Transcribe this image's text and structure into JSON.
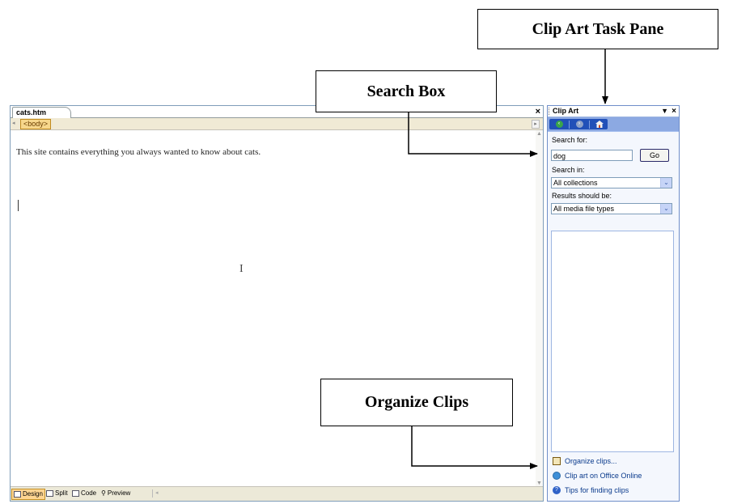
{
  "annotations": {
    "clip_art_task_pane": "Clip Art Task Pane",
    "search_box": "Search Box",
    "organize_clips": "Organize Clips"
  },
  "editor": {
    "tab_label": "cats.htm",
    "close_glyph": "×",
    "tag_selector": "<body>",
    "body_text": "This site contains everything you always wanted to know about cats.",
    "view_tabs": [
      {
        "label": "Design",
        "icon": "design-view-icon",
        "active": true
      },
      {
        "label": "Split",
        "icon": "split-view-icon",
        "active": false
      },
      {
        "label": "Code",
        "icon": "code-view-icon",
        "active": false
      },
      {
        "label": "Preview",
        "icon": "preview-view-icon",
        "active": false
      }
    ]
  },
  "task_pane": {
    "title": "Clip Art",
    "dropdown_glyph": "▼",
    "close_glyph": "×",
    "nav_icons": [
      "back-icon",
      "forward-icon",
      "home-icon"
    ],
    "search_for_label": "Search for:",
    "search_value": "dog",
    "go_label": "Go",
    "search_in_label": "Search in:",
    "search_in_value": "All collections",
    "results_label": "Results should be:",
    "results_value": "All media file types",
    "links": [
      {
        "label": "Organize clips...",
        "icon": "organize-clips-icon"
      },
      {
        "label": "Clip art on Office Online",
        "icon": "office-online-icon"
      },
      {
        "label": "Tips for finding clips",
        "icon": "help-icon"
      }
    ]
  },
  "colors": {
    "pane_blue": "#a6c0ef",
    "nav_blue": "#2150b8",
    "tag_highlight": "#f7d78c",
    "link_blue": "#0a3a8c"
  }
}
